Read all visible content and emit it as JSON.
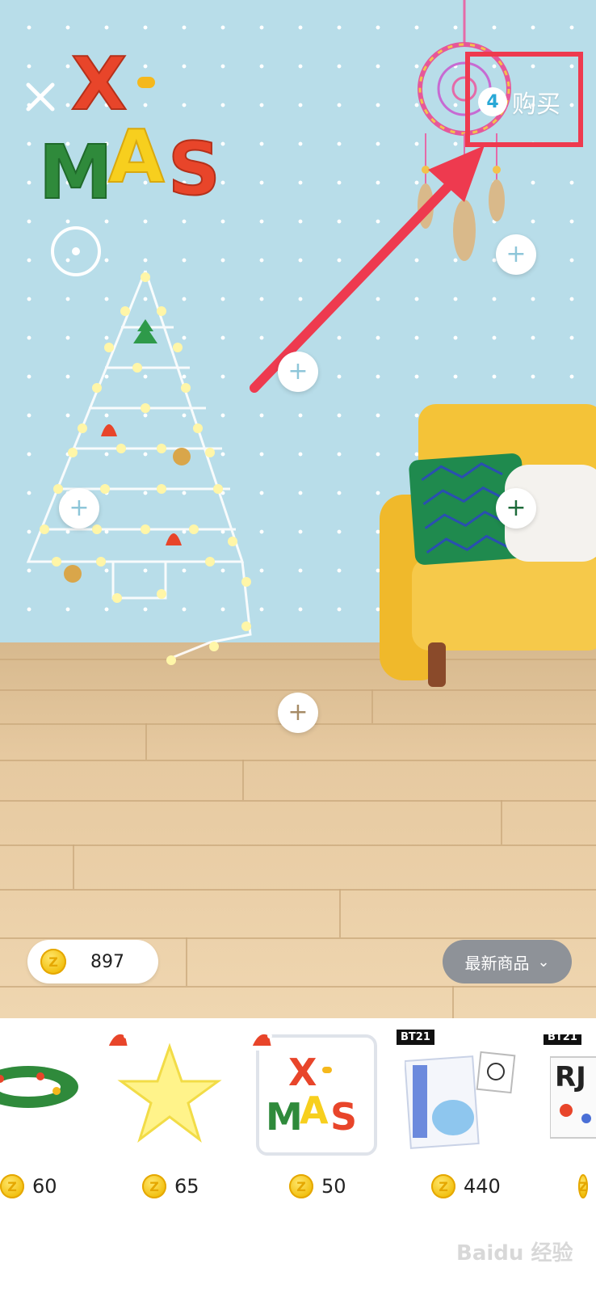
{
  "header": {
    "close_label": "×",
    "buy_count": "4",
    "buy_label": "购买",
    "logo_text": "X-MAS"
  },
  "scene": {
    "plus_symbol": "+"
  },
  "wallet": {
    "coins": "897"
  },
  "sort": {
    "label": "最新商品"
  },
  "items": [
    {
      "name": "wreath",
      "price": "60"
    },
    {
      "name": "star",
      "price": "65"
    },
    {
      "name": "xmas-sign",
      "price": "50",
      "selected": true,
      "logo": "X-MAS"
    },
    {
      "name": "koya-poster",
      "price": "440",
      "badge": "BT21"
    },
    {
      "name": "rj-poster",
      "price": "",
      "badge": "BT21"
    }
  ],
  "watermark": "Baidu 经验",
  "colors": {
    "wall": "#b8dde9",
    "highlight": "#ee3a4f",
    "coin": "#f1be0c",
    "sort_button": "#8e9298"
  }
}
